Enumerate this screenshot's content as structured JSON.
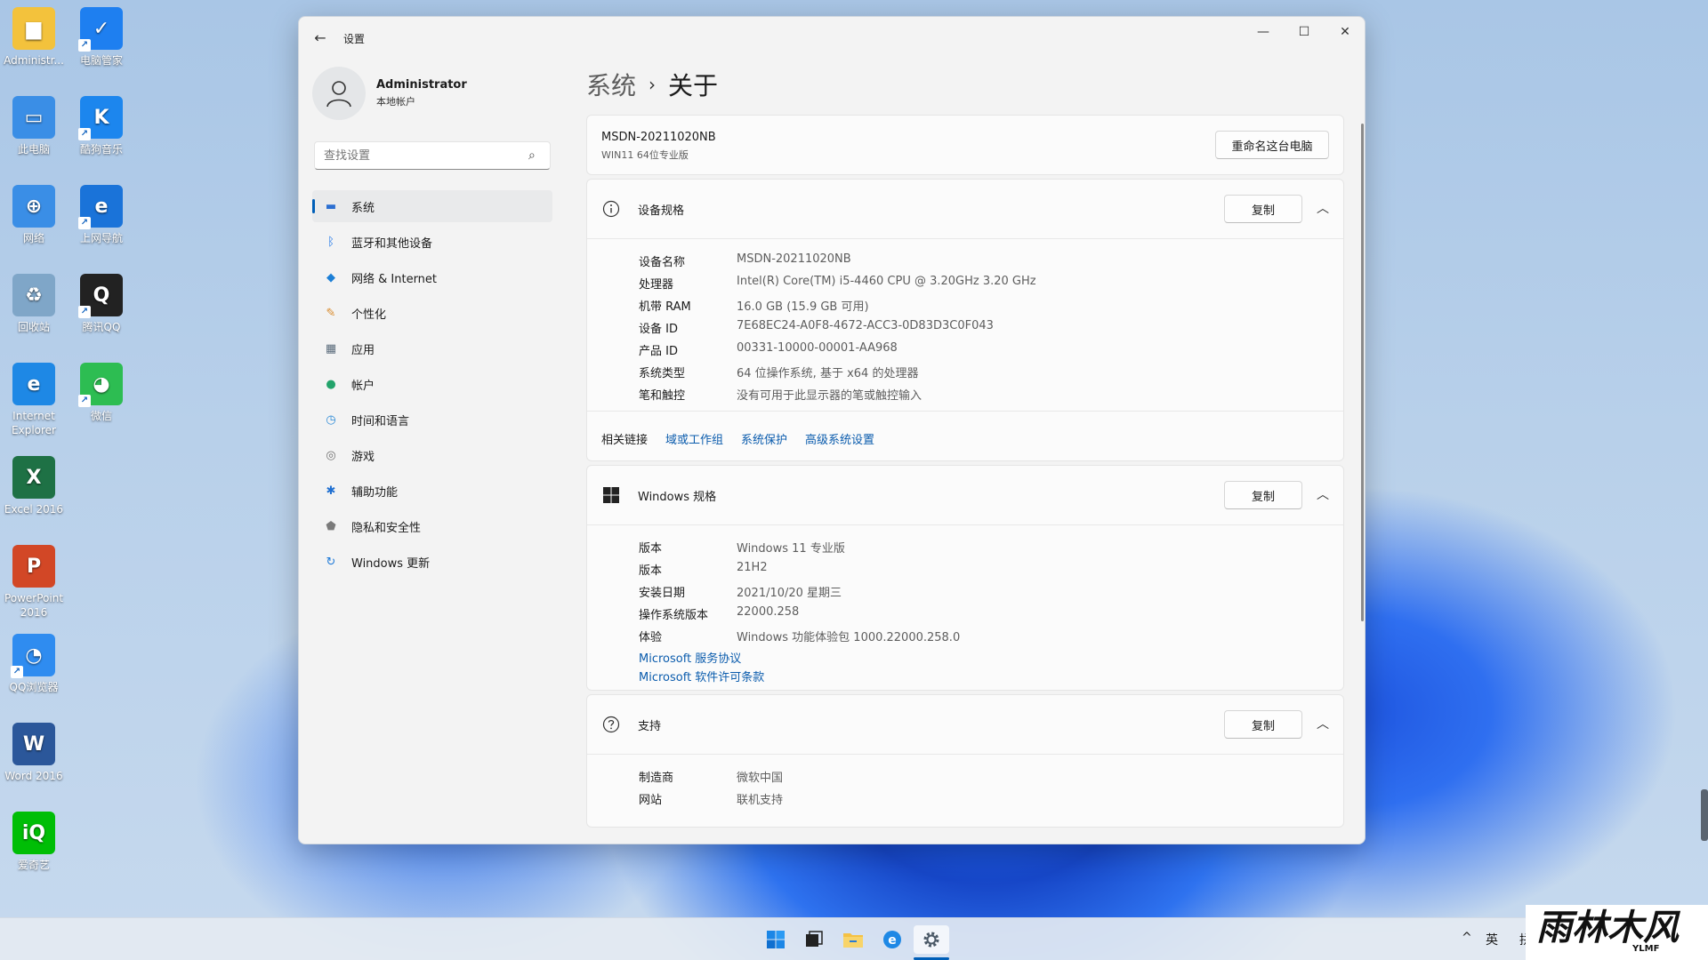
{
  "desktop": {
    "icons": [
      {
        "label": "Administr...",
        "color": "#f3c23c",
        "glyph": "▆"
      },
      {
        "label": "电脑管家",
        "color": "#1e7ff0",
        "glyph": "✓"
      },
      {
        "label": "此电脑",
        "color": "#3a8ee6",
        "glyph": "▭"
      },
      {
        "label": "酷狗音乐",
        "color": "#1c86ee",
        "glyph": "K"
      },
      {
        "label": "网络",
        "color": "#3a8ee6",
        "glyph": "⊕"
      },
      {
        "label": "上网导航",
        "color": "#1a73d9",
        "glyph": "e"
      },
      {
        "label": "回收站",
        "color": "#7fa6c8",
        "glyph": "♻"
      },
      {
        "label": "腾讯QQ",
        "color": "#222222",
        "glyph": "Q"
      },
      {
        "label": "Internet Explorer",
        "color": "#1e88e5",
        "glyph": "e"
      },
      {
        "label": "微信",
        "color": "#2dbd52",
        "glyph": "◕"
      },
      {
        "label": "Excel 2016",
        "color": "#1e7145",
        "glyph": "X"
      },
      {
        "label": "PowerPoint 2016",
        "color": "#d24726",
        "glyph": "P"
      },
      {
        "label": "QQ浏览器",
        "color": "#2f8cf0",
        "glyph": "◔"
      },
      {
        "label": "Word 2016",
        "color": "#2b579a",
        "glyph": "W"
      },
      {
        "label": "爱奇艺",
        "color": "#00be06",
        "glyph": "iQ"
      }
    ]
  },
  "window": {
    "title": "设置",
    "back_icon": "←",
    "controls": {
      "minimize": "—",
      "maximize": "☐",
      "close": "✕"
    }
  },
  "profile": {
    "name": "Administrator",
    "account_type": "本地帐户"
  },
  "search": {
    "placeholder": "查找设置"
  },
  "nav": [
    {
      "label": "系统",
      "icon": "display-icon",
      "color": "#2c6fd1",
      "glyph": "▬"
    },
    {
      "label": "蓝牙和其他设备",
      "icon": "bluetooth-icon",
      "color": "#1a73e8",
      "glyph": "ᛒ"
    },
    {
      "label": "网络 & Internet",
      "icon": "wifi-icon",
      "color": "#1c7fd6",
      "glyph": "◆"
    },
    {
      "label": "个性化",
      "icon": "brush-icon",
      "color": "#d98a2b",
      "glyph": "✎"
    },
    {
      "label": "应用",
      "icon": "apps-icon",
      "color": "#5a6b7b",
      "glyph": "▦"
    },
    {
      "label": "帐户",
      "icon": "person-icon",
      "color": "#23a36b",
      "glyph": "●"
    },
    {
      "label": "时间和语言",
      "icon": "clock-globe-icon",
      "color": "#2b8ad6",
      "glyph": "◷"
    },
    {
      "label": "游戏",
      "icon": "gamepad-icon",
      "color": "#707070",
      "glyph": "◎"
    },
    {
      "label": "辅助功能",
      "icon": "accessibility-icon",
      "color": "#1f6fd1",
      "glyph": "✱"
    },
    {
      "label": "隐私和安全性",
      "icon": "shield-icon",
      "color": "#7a7a7a",
      "glyph": "⬟"
    },
    {
      "label": "Windows 更新",
      "icon": "update-icon",
      "color": "#1f7ad8",
      "glyph": "↻"
    }
  ],
  "breadcrumb": {
    "parent": "系统",
    "separator": "›",
    "current": "关于"
  },
  "pc": {
    "name": "MSDN-20211020NB",
    "edition": "WIN11 64位专业版",
    "rename_button": "重命名这台电脑"
  },
  "device_specs": {
    "title": "设备规格",
    "copy_button": "复制",
    "rows": [
      {
        "k": "设备名称",
        "v": "MSDN-20211020NB"
      },
      {
        "k": "处理器",
        "v": "Intel(R) Core(TM) i5-4460  CPU @ 3.20GHz   3.20 GHz"
      },
      {
        "k": "机带 RAM",
        "v": "16.0 GB (15.9 GB 可用)"
      },
      {
        "k": "设备 ID",
        "v": "7E68EC24-A0F8-4672-ACC3-0D83D3C0F043"
      },
      {
        "k": "产品 ID",
        "v": "00331-10000-00001-AA968"
      },
      {
        "k": "系统类型",
        "v": "64 位操作系统, 基于 x64 的处理器"
      },
      {
        "k": "笔和触控",
        "v": "没有可用于此显示器的笔或触控输入"
      }
    ]
  },
  "related": {
    "heading": "相关链接",
    "links": [
      "域或工作组",
      "系统保护",
      "高级系统设置"
    ]
  },
  "windows_specs": {
    "title": "Windows 规格",
    "copy_button": "复制",
    "rows": [
      {
        "k": "版本",
        "v": "Windows 11 专业版"
      },
      {
        "k": "版本",
        "v": "21H2"
      },
      {
        "k": "安装日期",
        "v": "2021/10/20 星期三"
      },
      {
        "k": "操作系统版本",
        "v": "22000.258"
      },
      {
        "k": "体验",
        "v": "Windows 功能体验包 1000.22000.258.0"
      }
    ],
    "links": [
      "Microsoft 服务协议",
      "Microsoft 软件许可条款"
    ]
  },
  "support": {
    "title": "支持",
    "copy_button": "复制",
    "rows": [
      {
        "k": "制造商",
        "v": "微软中国"
      },
      {
        "k": "网站",
        "v": "联机支持"
      }
    ]
  },
  "taskbar": {
    "tray_chevron": "^",
    "ime": "英",
    "tray_extra": "拼"
  },
  "watermark": {
    "text": "雨林木风",
    "sub": "YLMF"
  },
  "colors": {
    "accent": "#005fb8",
    "link": "#0b5cad"
  }
}
